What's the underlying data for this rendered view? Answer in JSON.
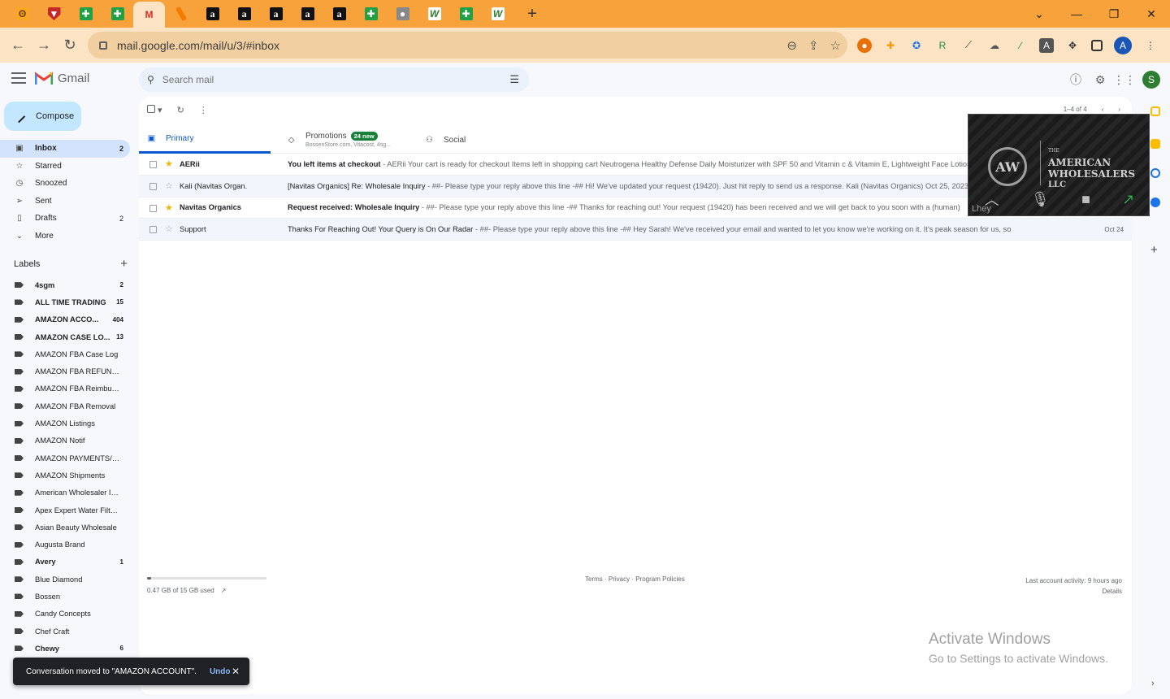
{
  "browser": {
    "tabs": [
      {
        "icon": "fox-icon",
        "glyph": "ʘ",
        "cls": "fav-fox"
      },
      {
        "icon": "shield-icon",
        "glyph": "▼",
        "cls": "fav-shield"
      },
      {
        "icon": "sheets-icon",
        "glyph": "✚",
        "cls": "fav-green"
      },
      {
        "icon": "sheets-icon",
        "glyph": "✚",
        "cls": "fav-green"
      },
      {
        "icon": "gmail-icon",
        "glyph": "M",
        "cls": "fav-gm",
        "active": true
      },
      {
        "icon": "pen-icon",
        "glyph": "",
        "cls": "fav-pen"
      },
      {
        "icon": "amazon-icon",
        "glyph": "a",
        "cls": "fav-amz"
      },
      {
        "icon": "amazon-icon",
        "glyph": "a",
        "cls": "fav-amz"
      },
      {
        "icon": "amazon-icon",
        "glyph": "a",
        "cls": "fav-amz"
      },
      {
        "icon": "amazon-icon",
        "glyph": "a",
        "cls": "fav-amz"
      },
      {
        "icon": "amazon-icon",
        "glyph": "a",
        "cls": "fav-amz"
      },
      {
        "icon": "sheets-icon",
        "glyph": "✚",
        "cls": "fav-green"
      },
      {
        "icon": "globe-icon",
        "glyph": "●",
        "cls": "fav-globe"
      },
      {
        "icon": "w-icon",
        "glyph": "W",
        "cls": "fav-w"
      },
      {
        "icon": "sheets-icon",
        "glyph": "✚",
        "cls": "fav-green"
      },
      {
        "icon": "w-icon",
        "glyph": "W",
        "cls": "fav-w"
      }
    ],
    "url": "mail.google.com/mail/u/3/#inbox",
    "profile_initial": "A"
  },
  "gmail": {
    "app_name": "Gmail",
    "search_placeholder": "Search mail",
    "account_initial": "S",
    "compose_label": "Compose",
    "nav": [
      {
        "label": "Inbox",
        "count": "2",
        "icon": "inbox-icon",
        "glyph": "▣",
        "active": true
      },
      {
        "label": "Starred",
        "count": "",
        "icon": "star-icon",
        "glyph": "☆"
      },
      {
        "label": "Snoozed",
        "count": "",
        "icon": "clock-icon",
        "glyph": "◷"
      },
      {
        "label": "Sent",
        "count": "",
        "icon": "send-icon",
        "glyph": "➢"
      },
      {
        "label": "Drafts",
        "count": "2",
        "icon": "draft-icon",
        "glyph": "▯"
      },
      {
        "label": "More",
        "count": "",
        "icon": "chevron-down-icon",
        "glyph": "⌄"
      }
    ],
    "labels_title": "Labels",
    "labels": [
      {
        "label": "4sgm",
        "count": "2",
        "bold": true
      },
      {
        "label": "ALL TIME TRADING",
        "count": "15",
        "bold": true
      },
      {
        "label": "AMAZON ACCO...",
        "count": "404",
        "bold": true
      },
      {
        "label": "AMAZON CASE LO...",
        "count": "13",
        "bold": true
      },
      {
        "label": "AMAZON FBA Case Log",
        "count": ""
      },
      {
        "label": "AMAZON FBA REFUNDS",
        "count": ""
      },
      {
        "label": "AMAZON FBA Reimburs...",
        "count": ""
      },
      {
        "label": "AMAZON FBA Removal",
        "count": ""
      },
      {
        "label": "AMAZON Listings",
        "count": ""
      },
      {
        "label": "AMAZON Notif",
        "count": ""
      },
      {
        "label": "AMAZON PAYMENTS/SE...",
        "count": ""
      },
      {
        "label": "AMAZON Shipments",
        "count": ""
      },
      {
        "label": "American Wholesaler In...",
        "count": ""
      },
      {
        "label": "Apex Expert Water Filters",
        "count": ""
      },
      {
        "label": "Asian Beauty Wholesale",
        "count": ""
      },
      {
        "label": "Augusta Brand",
        "count": ""
      },
      {
        "label": "Avery",
        "count": "1",
        "bold": true
      },
      {
        "label": "Blue Diamond",
        "count": ""
      },
      {
        "label": "Bossen",
        "count": ""
      },
      {
        "label": "Candy Concepts",
        "count": ""
      },
      {
        "label": "Chef Craft",
        "count": ""
      },
      {
        "label": "Chewy",
        "count": "6",
        "bold": true
      }
    ],
    "tabs": [
      {
        "label": "Primary",
        "icon": "inbox-icon",
        "glyph": "▣",
        "active": true
      },
      {
        "label": "Promotions",
        "icon": "tag-icon",
        "glyph": "◇",
        "badge": "24 new",
        "sub": "BossenStore.com, Vitacost, 4sg..."
      },
      {
        "label": "Social",
        "icon": "people-icon",
        "glyph": "⚇"
      }
    ],
    "pager": "1–4 of 4",
    "emails": [
      {
        "from": "AERii",
        "subject": "You left items at checkout",
        "snippet": " - AERii Your cart is ready for checkout Items left in shopping cart Neutrogena Healthy Defense Daily Moisturizer with SPF 50 and Vitamin c & Vitamin E, Lightweight Face Lotion",
        "date": "",
        "starred": true,
        "unread": true
      },
      {
        "from": "Kali (Navitas Organ.",
        "subject": "[Navitas Organics] Re: Wholesale Inquiry",
        "snippet": " - ##- Please type your reply above this line -## Hi! We've updated your request (19420). Just hit reply to send us a response. Kali (Navitas Organics) Oct 25, 2023",
        "date": "",
        "starred": false,
        "unread": false
      },
      {
        "from": "Navitas Organics",
        "subject": "Request received: Wholesale Inquiry",
        "snippet": " - ##- Please type your reply above this line -## Thanks for reaching out! Your request (19420) has been received and we will get back to you soon with a (human)",
        "date": "",
        "starred": true,
        "unread": true
      },
      {
        "from": "Support",
        "subject": "Thanks For Reaching Out! Your Query is On Our Radar",
        "snippet": " - ##- Please type your reply above this line -## Hey Sarah! We've received your email and wanted to let you know we're working on it. It's peak season for us, so",
        "date": "Oct 24",
        "starred": false,
        "unread": false
      }
    ],
    "storage": {
      "text": "0.47 GB of 15 GB used",
      "fraction": 0.031
    },
    "footer_links": "Terms · Privacy · Program Policies",
    "last_activity": "Last account activity: 9 hours ago",
    "details": "Details"
  },
  "video": {
    "the": "THE",
    "line1": "AMERICAN",
    "line2": "WHOLESALERS",
    "line3": "LLC",
    "monogram": "AW",
    "caption": "Lhey"
  },
  "snackbar": {
    "message": "Conversation moved to \"AMAZON ACCOUNT\".",
    "undo": "Undo"
  },
  "watermark": {
    "line1": "Activate Windows",
    "line2": "Go to Settings to activate Windows."
  }
}
